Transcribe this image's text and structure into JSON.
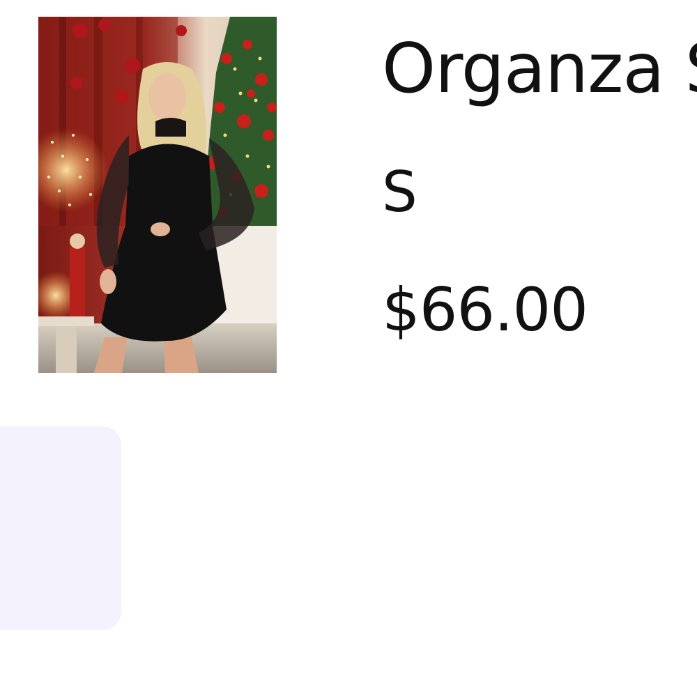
{
  "product": {
    "title": "Organza S",
    "size": "S",
    "price": "$66.00",
    "image_description": "model-in-black-velvet-organza-dress"
  },
  "next_item": {
    "background": "#f4f2fd"
  },
  "colors": {
    "text": "#111111",
    "background": "#ffffff",
    "card": "#f4f2fd"
  }
}
